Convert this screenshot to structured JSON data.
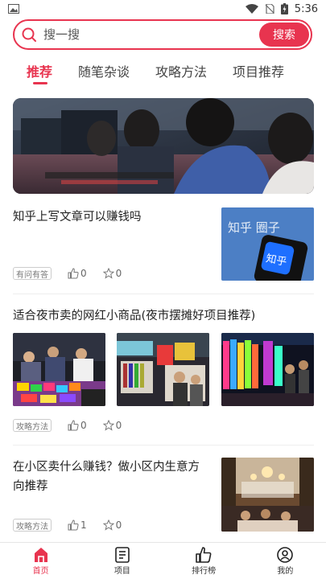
{
  "status_bar": {
    "time": "5:36"
  },
  "search": {
    "placeholder": "搜一搜",
    "button_label": "搜索"
  },
  "tabs": [
    {
      "label": "推荐",
      "active": true
    },
    {
      "label": "随笔杂谈",
      "active": false
    },
    {
      "label": "攻略方法",
      "active": false
    },
    {
      "label": "项目推荐",
      "active": false
    }
  ],
  "articles": [
    {
      "title": "知乎上写文章可以赚钱吗",
      "tag": "有问有答",
      "likes": "0",
      "favorites": "0",
      "thumb_text": "知乎 圈子",
      "thumb_app_text": "知乎"
    },
    {
      "title": "适合夜市卖的网红小商品(夜市摆摊好项目推荐)",
      "tag": "攻略方法",
      "likes": "0",
      "favorites": "0"
    },
    {
      "title": "在小区卖什么赚钱？做小区内生意方向推荐",
      "tag": "攻略方法",
      "likes": "1",
      "favorites": "0"
    }
  ],
  "bottom_nav": [
    {
      "label": "首页",
      "icon": "home-icon",
      "active": true
    },
    {
      "label": "项目",
      "icon": "document-icon",
      "active": false
    },
    {
      "label": "排行榜",
      "icon": "thumbs-up-icon",
      "active": false
    },
    {
      "label": "我的",
      "icon": "user-icon",
      "active": false
    }
  ],
  "colors": {
    "accent": "#e8344f"
  }
}
